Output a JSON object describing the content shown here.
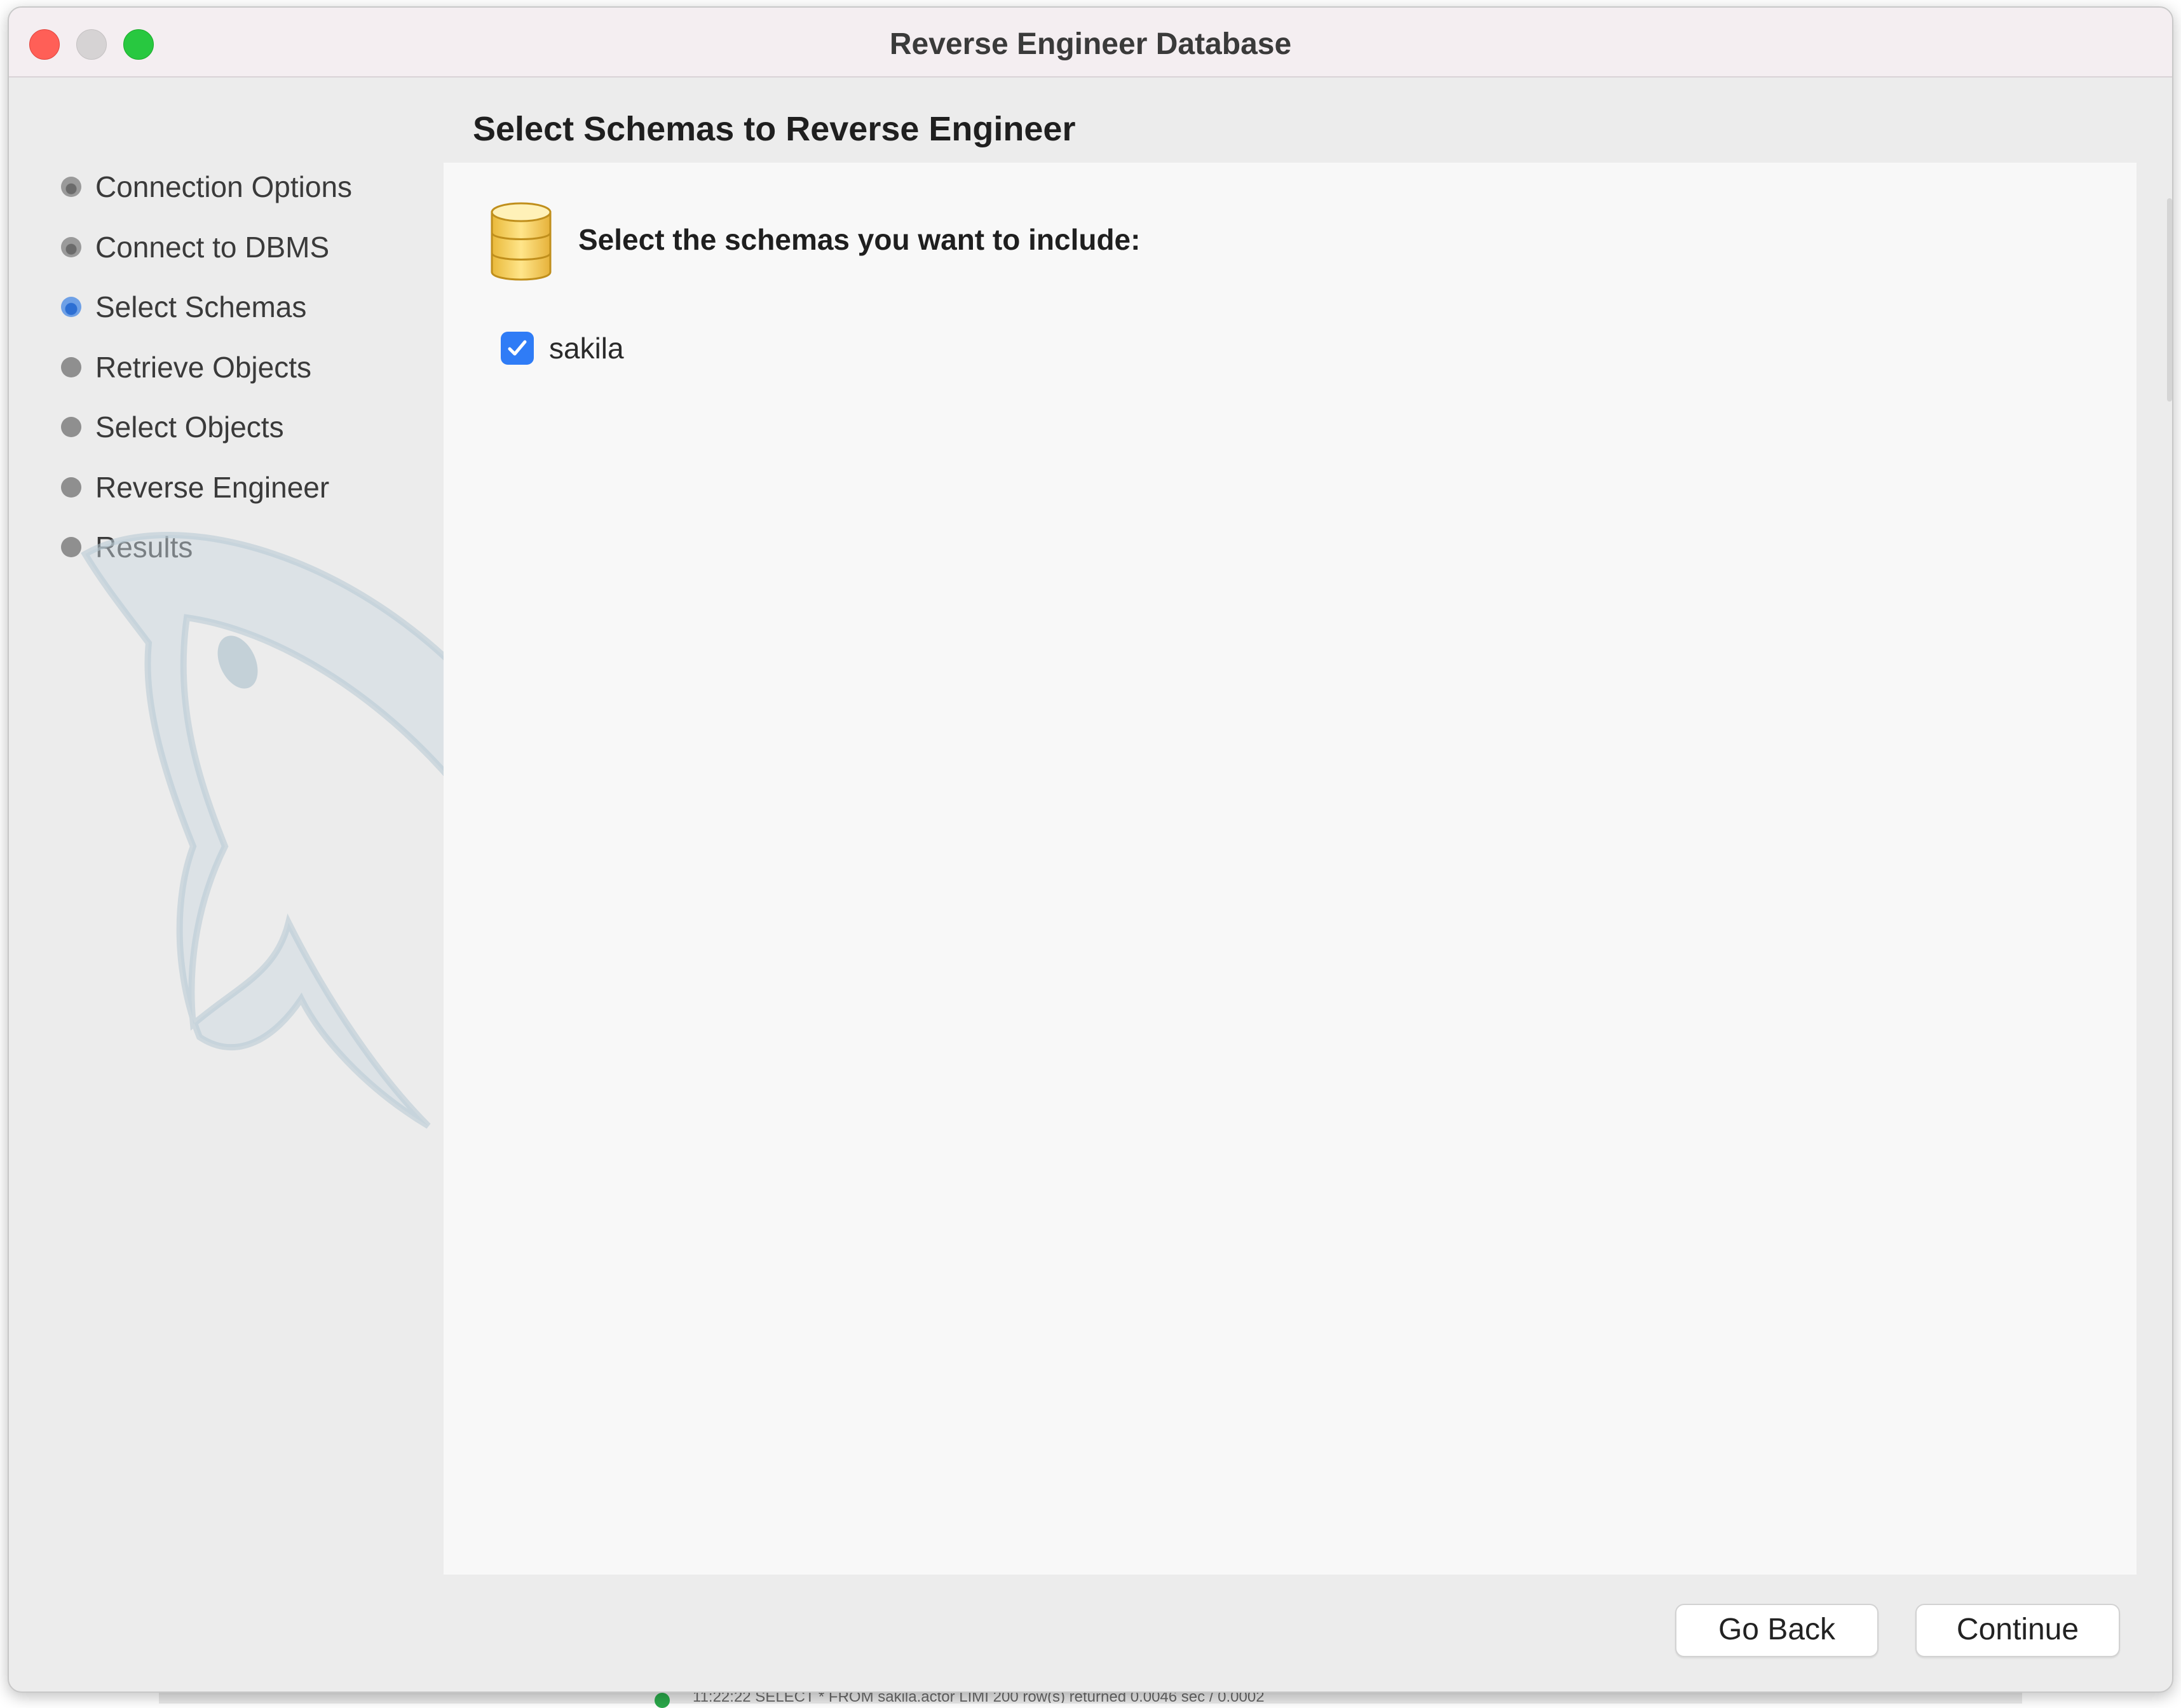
{
  "window": {
    "title": "Reverse Engineer Database"
  },
  "page": {
    "heading": "Select Schemas to Reverse Engineer"
  },
  "steps": [
    {
      "label": "Connection Options",
      "state": "done"
    },
    {
      "label": "Connect to DBMS",
      "state": "done"
    },
    {
      "label": "Select Schemas",
      "state": "current"
    },
    {
      "label": "Retrieve Objects",
      "state": "pending"
    },
    {
      "label": "Select Objects",
      "state": "pending"
    },
    {
      "label": "Reverse Engineer",
      "state": "pending"
    },
    {
      "label": "Results",
      "state": "pending"
    }
  ],
  "panel": {
    "heading": "Select the schemas you want to include:",
    "icon": "database-icon",
    "schemas": [
      {
        "name": "sakila",
        "checked": true
      }
    ]
  },
  "buttons": {
    "back": "Go Back",
    "continue": "Continue"
  },
  "background_app": {
    "status": "11:22:22      SELECT * FROM sakila.actor LIMI      200 row(s) returned                                                          0.0046 sec / 0.0002"
  },
  "colors": {
    "accent": "#2f7cf6",
    "close": "#ff5f57",
    "maximize": "#28c840",
    "panel_bg": "#f8f8f8",
    "window_bg": "#ececec"
  }
}
